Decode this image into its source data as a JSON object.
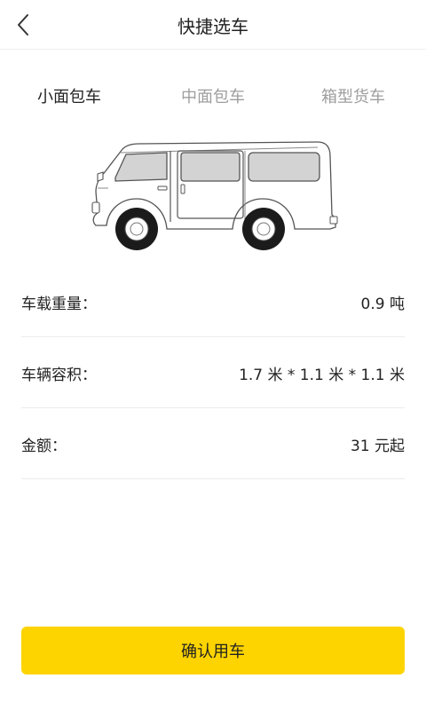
{
  "header": {
    "title": "快捷选车",
    "back_icon": "chevron-left-icon"
  },
  "tabs": [
    {
      "label": "小面包车",
      "active": true
    },
    {
      "label": "中面包车",
      "active": false
    },
    {
      "label": "箱型货车",
      "active": false
    }
  ],
  "vehicle_image": "van-illustration",
  "specs": {
    "weight": {
      "label": "车载重量：",
      "value": "0.9 吨"
    },
    "volume": {
      "label": "车辆容积：",
      "value": "1.7 米 * 1.1 米 * 1.1 米"
    },
    "price": {
      "label": "金额：",
      "value": "31 元起"
    }
  },
  "confirm_button": {
    "label": "确认用车"
  },
  "colors": {
    "accent": "#fdd400",
    "text_primary": "#222222",
    "text_inactive": "#9e9e9e",
    "divider": "#ececec"
  }
}
